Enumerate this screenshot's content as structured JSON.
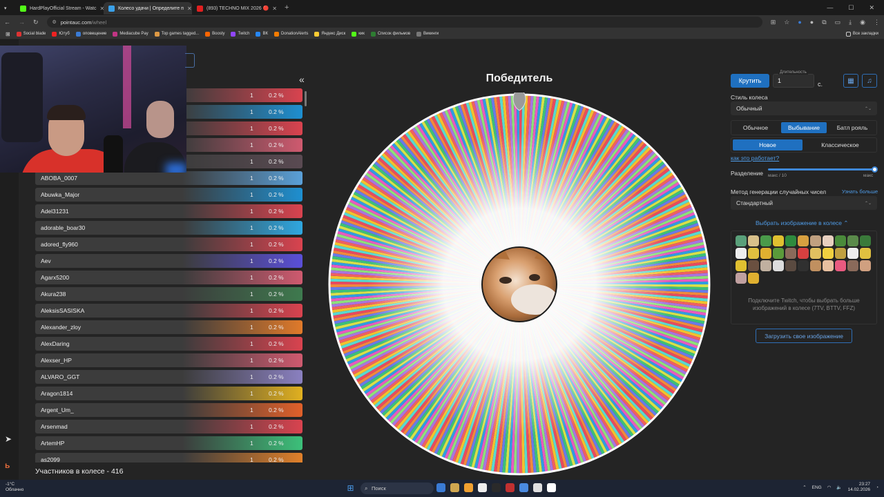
{
  "browser": {
    "tabs": [
      {
        "label": "HardPlayOfficial Stream - Watc",
        "color": "#53fc18",
        "active": false
      },
      {
        "label": "Колесо удачи | Определите п",
        "color": "#3aa0e8",
        "active": true
      },
      {
        "label": "(893) TECHNO MIX 2026 🔴",
        "color": "#e02020",
        "active": false
      }
    ],
    "url_host": "pointauc.com",
    "url_path": "/wheel",
    "bookmarks": [
      "Social blade",
      "Ютуб",
      "оповещение",
      "Mediacube Pay",
      "Top games tagged...",
      "Boosty",
      "Twitch",
      "ВК",
      "DonationAlerts",
      "Яндекс Диск",
      "кик",
      "Список фильмов",
      "Викинги"
    ],
    "bookmark_colors": [
      "#d33",
      "#e22",
      "#3a7bd5",
      "#c13584",
      "#d94",
      "#f60",
      "#9146ff",
      "#2787f5",
      "#f57c00",
      "#fc3",
      "#53fc18",
      "#2e7d32",
      "#777"
    ],
    "all_bookmarks": "Все закладки"
  },
  "participants": {
    "rows": [
      {
        "name": "",
        "count": "1",
        "percent": "0.2 %",
        "color": "#d9434f"
      },
      {
        "name": "",
        "count": "1",
        "percent": "0.2 %",
        "color": "#1e8fd0"
      },
      {
        "name": "",
        "count": "1",
        "percent": "0.2 %",
        "color": "#d9434f"
      },
      {
        "name": "",
        "count": "1",
        "percent": "0.2 %",
        "color": "#cf5a6f"
      },
      {
        "name": "",
        "count": "1",
        "percent": "0.2 %",
        "color": "#5a4a52"
      },
      {
        "name": "ABOBA_0007",
        "count": "1",
        "percent": "0.2 %",
        "color": "#5aa0d8"
      },
      {
        "name": "Abuwka_Major",
        "count": "1",
        "percent": "0.2 %",
        "color": "#1e8fd0"
      },
      {
        "name": "Adel31231",
        "count": "1",
        "percent": "0.2 %",
        "color": "#d9434f"
      },
      {
        "name": "adorable_boar30",
        "count": "1",
        "percent": "0.2 %",
        "color": "#2fa7e0"
      },
      {
        "name": "adored_fly960",
        "count": "1",
        "percent": "0.2 %",
        "color": "#d9434f"
      },
      {
        "name": "Aev",
        "count": "1",
        "percent": "0.2 %",
        "color": "#5a4fd8"
      },
      {
        "name": "Agarx5200",
        "count": "1",
        "percent": "0.2 %",
        "color": "#cf5a6f"
      },
      {
        "name": "Akura238",
        "count": "1",
        "percent": "0.2 %",
        "color": "#3e7a4e"
      },
      {
        "name": "AleksisSASISKA",
        "count": "1",
        "percent": "0.2 %",
        "color": "#d9434f"
      },
      {
        "name": "Alexander_zloy",
        "count": "1",
        "percent": "0.2 %",
        "color": "#e07a2a"
      },
      {
        "name": "AlexDaring",
        "count": "1",
        "percent": "0.2 %",
        "color": "#d9434f"
      },
      {
        "name": "Alexser_HP",
        "count": "1",
        "percent": "0.2 %",
        "color": "#cf5a6f"
      },
      {
        "name": "ALVARO_GGT",
        "count": "1",
        "percent": "0.2 %",
        "color": "#8a80c0"
      },
      {
        "name": "Aragon1814",
        "count": "1",
        "percent": "0.2 %",
        "color": "#e0b020"
      },
      {
        "name": "Argent_Um_",
        "count": "1",
        "percent": "0.2 %",
        "color": "#e0602a"
      },
      {
        "name": "Arsenmad",
        "count": "1",
        "percent": "0.2 %",
        "color": "#d9434f"
      },
      {
        "name": "ArtemHP",
        "count": "1",
        "percent": "0.2 %",
        "color": "#3cc07a"
      },
      {
        "name": "as2099",
        "count": "1",
        "percent": "0.2 %",
        "color": "#e0802a"
      }
    ],
    "footer": "Участников в колесе - 416"
  },
  "wheel": {
    "title": "Победитель",
    "segment_count": 416,
    "palette": [
      "#e84a5f",
      "#2f9ee0",
      "#f2c12e",
      "#3cc07a",
      "#a974e0",
      "#f08a3c",
      "#e85ac0",
      "#5ad8d0",
      "#d6e04a",
      "#f06060",
      "#6a7ae8",
      "#8ee07a"
    ]
  },
  "controls": {
    "spin_label": "Крутить",
    "duration_label": "Длительность",
    "duration_value": "1",
    "duration_unit": "с.",
    "style_label": "Стиль колеса",
    "style_value": "Обычный",
    "modes": [
      "Обычное",
      "Выбывание",
      "Батл рояль"
    ],
    "active_mode": "Выбывание",
    "submodes": [
      "Новое",
      "Классическое"
    ],
    "active_submode": "Новое",
    "how_it_works": "как это работает?",
    "split_label": "Разделение",
    "split_min": "макс / 10",
    "split_max": "макс",
    "split_value": 1.0,
    "rng_label": "Метод генерации случайных чисел",
    "rng_learn_more": "Узнать больше",
    "rng_value": "Стандартный",
    "image_toggle": "Выбрать изображение в колесе",
    "twitch_note": "Подключите Twitch, чтобы выбрать больше изображений в колесе (7TV, BTTV, FFZ)",
    "upload_label": "Загрузить свое изображение",
    "emote_colors": [
      "#5aa07a",
      "#d8c08a",
      "#4a9a4a",
      "#e0c030",
      "#2e8a3e",
      "#d8a040",
      "#c0a080",
      "#e8d0c0",
      "#4a8a3a",
      "#5a8a4a",
      "#3a7a3a",
      "#eeeeee",
      "#e0c040",
      "#e0b030",
      "#5a9a3a",
      "#8a6a5a",
      "#d84040",
      "#e0c060",
      "#f0d040",
      "#c0a040",
      "#eeeeee",
      "#e0c040",
      "#e0c030",
      "#6a5040",
      "#c0b0a0",
      "#dddddd",
      "#5a4a40",
      "#303030",
      "#c09060",
      "#e8c0a0",
      "#e85a80",
      "#8a6a5a",
      "#d0a080",
      "#c0a0a0",
      "#e0b030"
    ]
  },
  "taskbar": {
    "weather_temp": "-1°C",
    "weather_desc": "Облачно",
    "search": "Поиск",
    "lang": "ENG",
    "time": "23:27",
    "date": "14.02.2026",
    "app_colors": [
      "#3a7bd5",
      "#cfa650",
      "#f0a030",
      "#eeeeee",
      "#2a2a2a",
      "#c03030",
      "#4a8ae0",
      "#e0e0e0",
      "#ffffff"
    ]
  }
}
